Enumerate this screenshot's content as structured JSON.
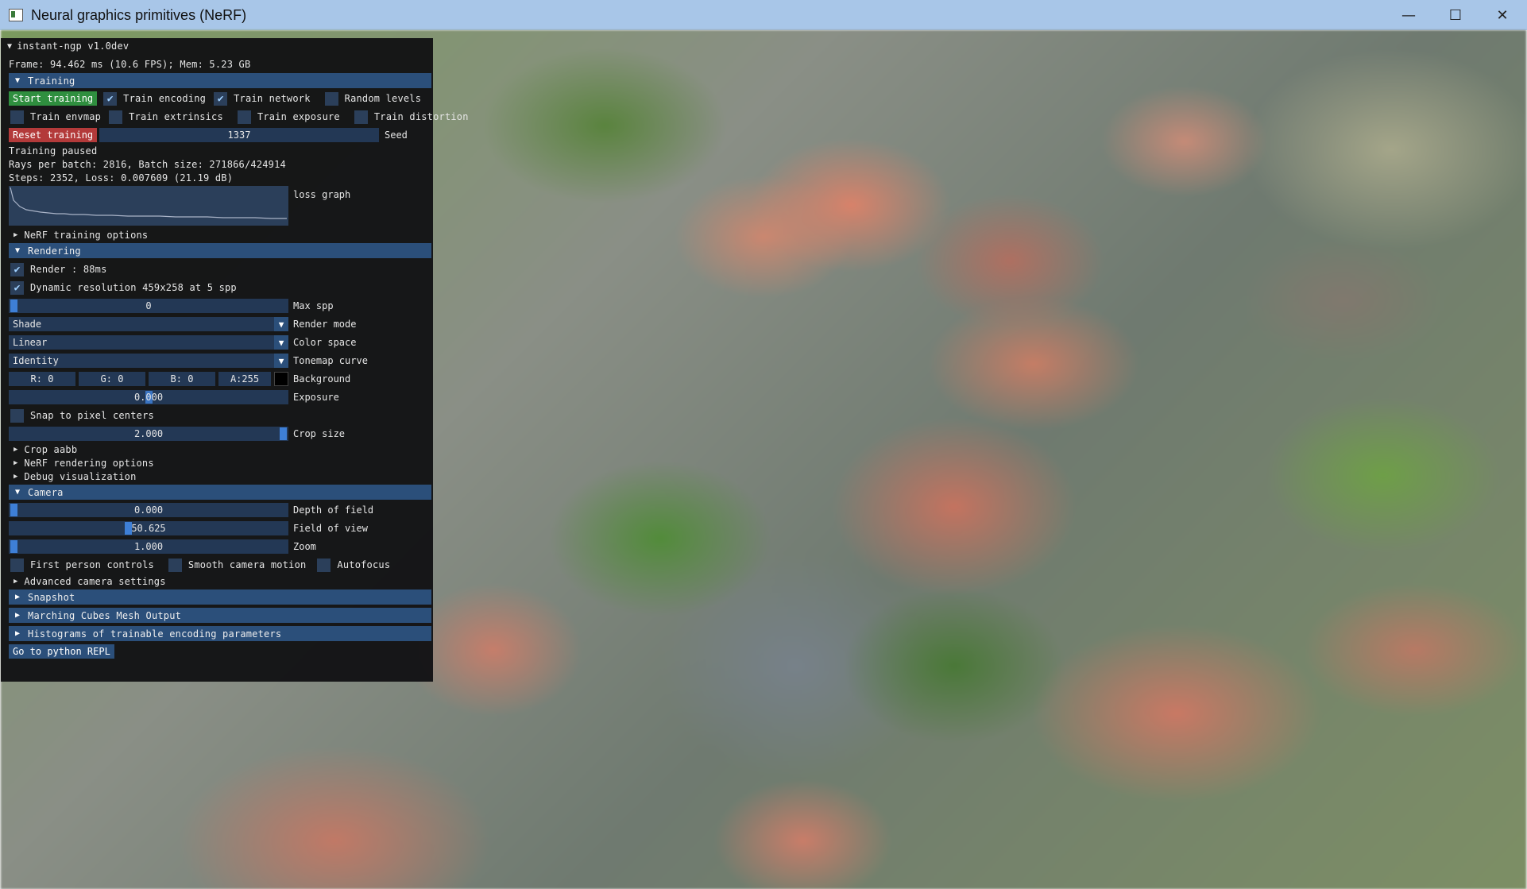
{
  "window": {
    "title": "Neural graphics primitives (NeRF)",
    "minimize": "—",
    "maximize": "☐",
    "close": "✕"
  },
  "panel": {
    "title": "instant-ngp v1.0dev",
    "frame_info": "Frame: 94.462 ms (10.6 FPS); Mem: 5.23 GB",
    "training": {
      "header": "Training",
      "start_training": "Start training",
      "train_encoding": "Train encoding",
      "train_encoding_checked": true,
      "train_network": "Train network",
      "train_network_checked": true,
      "random_levels": "Random levels",
      "random_levels_checked": false,
      "train_envmap": "Train envmap",
      "train_envmap_checked": false,
      "train_extrinsics": "Train extrinsics",
      "train_extrinsics_checked": false,
      "train_exposure": "Train exposure",
      "train_exposure_checked": false,
      "train_distortion": "Train distortion",
      "train_distortion_checked": false,
      "reset_training": "Reset training",
      "seed_value": "1337",
      "seed_label": "Seed",
      "status": "Training paused",
      "rays_info": "Rays per batch: 2816, Batch size: 271866/424914",
      "steps_info": "Steps: 2352, Loss: 0.007609 (21.19 dB)",
      "loss_graph_label": "loss graph",
      "nerf_training_options": "NeRF training options"
    },
    "rendering": {
      "header": "Rendering",
      "render": "Render : 88ms",
      "render_checked": true,
      "dynamic_resolution": "Dynamic resolution 459x258 at 5 spp",
      "dynamic_resolution_checked": true,
      "max_spp_value": "0",
      "max_spp_label": "Max spp",
      "render_mode_value": "Shade",
      "render_mode_label": "Render mode",
      "color_space_value": "Linear",
      "color_space_label": "Color space",
      "tonemap_value": "Identity",
      "tonemap_label": "Tonemap curve",
      "bg_r": "R:  0",
      "bg_g": "G:  0",
      "bg_b": "B:  0",
      "bg_a": "A:255",
      "background_label": "Background",
      "exposure_value": "0.000",
      "exposure_label": "Exposure",
      "snap_to_pixel": "Snap to pixel centers",
      "snap_checked": false,
      "crop_size_value": "2.000",
      "crop_size_label": "Crop size",
      "crop_aabb": "Crop aabb",
      "nerf_rendering_options": "NeRF rendering options",
      "debug_visualization": "Debug visualization"
    },
    "camera": {
      "header": "Camera",
      "dof_value": "0.000",
      "dof_label": "Depth of field",
      "fov_value": "50.625",
      "fov_label": "Field of view",
      "zoom_value": "1.000",
      "zoom_label": "Zoom",
      "first_person": "First person controls",
      "first_person_checked": false,
      "smooth_camera": "Smooth camera motion",
      "smooth_camera_checked": false,
      "autofocus": "Autofocus",
      "autofocus_checked": false,
      "advanced_camera": "Advanced camera settings"
    },
    "snapshot_header": "Snapshot",
    "marching_cubes_header": "Marching Cubes Mesh Output",
    "histograms_header": "Histograms of trainable encoding parameters",
    "python_repl": "Go to python REPL"
  },
  "colors": {
    "header_blue": "#2b4f7a",
    "start_green": "#2f8f3f",
    "reset_red": "#b33a3a",
    "titlebar": "#a8c6e8"
  },
  "icons": {
    "app": "app-window-icon",
    "collapse": "triangle-down-icon",
    "expand": "triangle-right-icon",
    "check": "check-icon",
    "dropdown": "dropdown-arrow-icon"
  }
}
